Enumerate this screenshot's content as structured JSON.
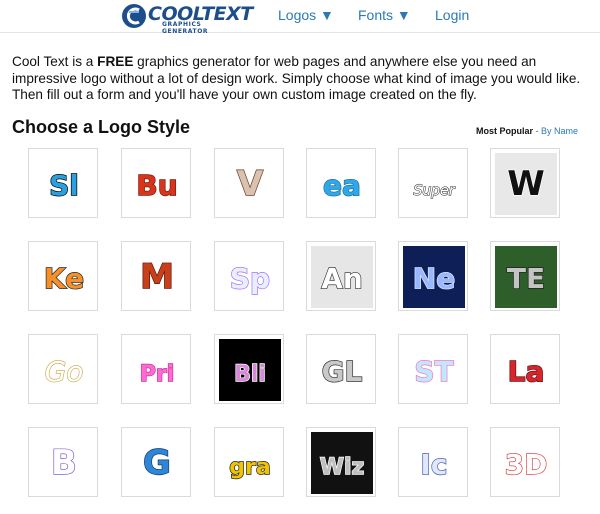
{
  "header": {
    "logo_text": "COOLTEXT",
    "logo_subtitle": "GRAPHICS GENERATOR",
    "nav": [
      {
        "label": "Logos ▼"
      },
      {
        "label": "Fonts ▼"
      },
      {
        "label": "Login"
      }
    ]
  },
  "intro": {
    "part1": "Cool Text is a ",
    "bold": "FREE",
    "part2": " graphics generator for web pages and anywhere else you need an impressive logo without a lot of design work.  Simply choose what kind of image you would like. Then fill out a form and you'll have your own custom image created on the fly."
  },
  "section": {
    "title": "Choose a Logo Style",
    "sort_active": "Most Popular",
    "sort_sep": " - ",
    "sort_link": "By Name"
  },
  "tiles": [
    {
      "text": "Sl",
      "bg": "#ffffff",
      "fill": "#2aa0e0",
      "stroke": "#000000"
    },
    {
      "text": "Bu",
      "bg": "#ffffff",
      "fill": "#d8341c",
      "stroke": "#7a1a0c"
    },
    {
      "text": "V",
      "bg": "#ffffff",
      "fill": "#d9c2b0",
      "stroke": "#6a3a28"
    },
    {
      "text": "ea",
      "bg": "#ffffff",
      "fill": "#2fa8e8",
      "stroke": "#1b6fa8"
    },
    {
      "text": "Super",
      "bg": "#ffffff",
      "fill": "#ffffff",
      "stroke": "#444444"
    },
    {
      "text": "W",
      "bg": "#e8e8e8",
      "fill": "#111111",
      "stroke": "#ffffff"
    },
    {
      "text": "Ke",
      "bg": "#ffffff",
      "fill": "#f5902a",
      "stroke": "#222222"
    },
    {
      "text": "M",
      "bg": "#ffffff",
      "fill": "#c8401a",
      "stroke": "#5a1408"
    },
    {
      "text": "Sp",
      "bg": "#ffffff",
      "fill": "#e8f0ff",
      "stroke": "#a66cff"
    },
    {
      "text": "An",
      "bg": "#e6e6e6",
      "fill": "#ffffff",
      "stroke": "#222222"
    },
    {
      "text": "Ne",
      "bg": "#0e1e56",
      "fill": "#9bb8ff",
      "stroke": "#dfe8ff"
    },
    {
      "text": "TE",
      "bg": "#2e5e2a",
      "fill": "#c4c4c4",
      "stroke": "#222222"
    },
    {
      "text": "Go",
      "bg": "#ffffff",
      "fill": "#ffffff",
      "stroke": "#c9a23a"
    },
    {
      "text": "Pri",
      "bg": "#ffffff",
      "fill": "#ff6bd1",
      "stroke": "#cc2f9e"
    },
    {
      "text": "Bli",
      "bg": "#000000",
      "fill": "#d58ad7",
      "stroke": "#ffffff"
    },
    {
      "text": "GL",
      "bg": "#ffffff",
      "fill": "#c9c9c9",
      "stroke": "#333333"
    },
    {
      "text": "ST",
      "bg": "#ffffff",
      "fill": "#bfe7ff",
      "stroke": "#ff6fb4"
    },
    {
      "text": "La",
      "bg": "#ffffff",
      "fill": "#d7262b",
      "stroke": "#6a0d12"
    },
    {
      "text": "B",
      "bg": "#ffffff",
      "fill": "#ffffff",
      "stroke": "#6f3bd8"
    },
    {
      "text": "G",
      "bg": "#ffffff",
      "fill": "#2f86d6",
      "stroke": "#0f3f7a"
    },
    {
      "text": "gra",
      "bg": "#ffffff",
      "fill": "#f2c300",
      "stroke": "#1c1c1c"
    },
    {
      "text": "Wiz",
      "bg": "#111111",
      "fill": "#bfbfbf",
      "stroke": "#ffffff"
    },
    {
      "text": "Ic",
      "bg": "#ffffff",
      "fill": "#dfe8ff",
      "stroke": "#4a5ea8"
    },
    {
      "text": "3D",
      "bg": "#ffffff",
      "fill": "#ffffff",
      "stroke": "#d7262b"
    }
  ]
}
